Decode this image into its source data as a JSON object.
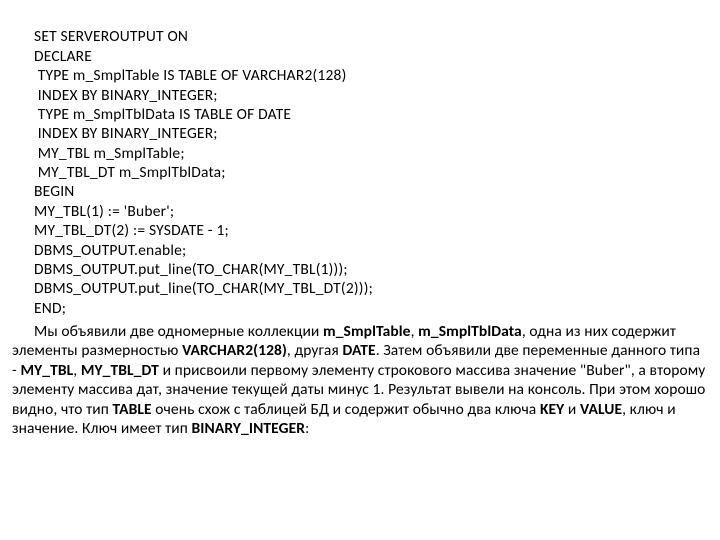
{
  "code": {
    "l1": "SET SERVEROUTPUT ON",
    "l2": "DECLARE",
    "l3": " TYPE m_SmplTable IS TABLE OF VARCHAR2(128)",
    "l4": " INDEX BY BINARY_INTEGER;",
    "l5": " TYPE m_SmplTblData IS TABLE OF DATE",
    "l6": " INDEX BY BINARY_INTEGER;",
    "l7": " MY_TBL m_SmplTable;",
    "l8": " MY_TBL_DT m_SmplTblData;",
    "l9": "BEGIN",
    "l10": "MY_TBL(1) := 'Buber';",
    "l11": "MY_TBL_DT(2) := SYSDATE - 1;",
    "l12": "DBMS_OUTPUT.enable;",
    "l13": "DBMS_OUTPUT.put_line(TO_CHAR(MY_TBL(1)));",
    "l14": "DBMS_OUTPUT.put_line(TO_CHAR(MY_TBL_DT(2)));",
    "l15": "END;"
  },
  "prose": {
    "t1": "Мы объявили две одномерные коллекции ",
    "b1": "m_SmplTable",
    "t2": ", ",
    "b2": "m_SmplTblData",
    "t3": ", одна из них содержит элементы размерностью ",
    "b3": "VARCHAR2(128)",
    "t4": ", другая ",
    "b4": "DATE",
    "t5": ". Затем объявили две переменные данного типа - ",
    "b5": "MY_TBL",
    "t6": ", ",
    "b6": "MY_TBL_DT",
    "t7": " и присвоили первому элементу строкового массива значение \"Buber\", а второму элементу массива дат, значение текущей даты минус 1. Результат вывели на консоль. При этом хорошо видно, что тип ",
    "b7": "TABLE",
    "t8": " очень схож с таблицей БД и содержит обычно два ключа ",
    "b8": "KEY",
    "t9": " и ",
    "b9": "VALUE",
    "t10": ", ключ и значение. Ключ имеет тип ",
    "b10": "BINARY_INTEGER",
    "t11": ":"
  }
}
